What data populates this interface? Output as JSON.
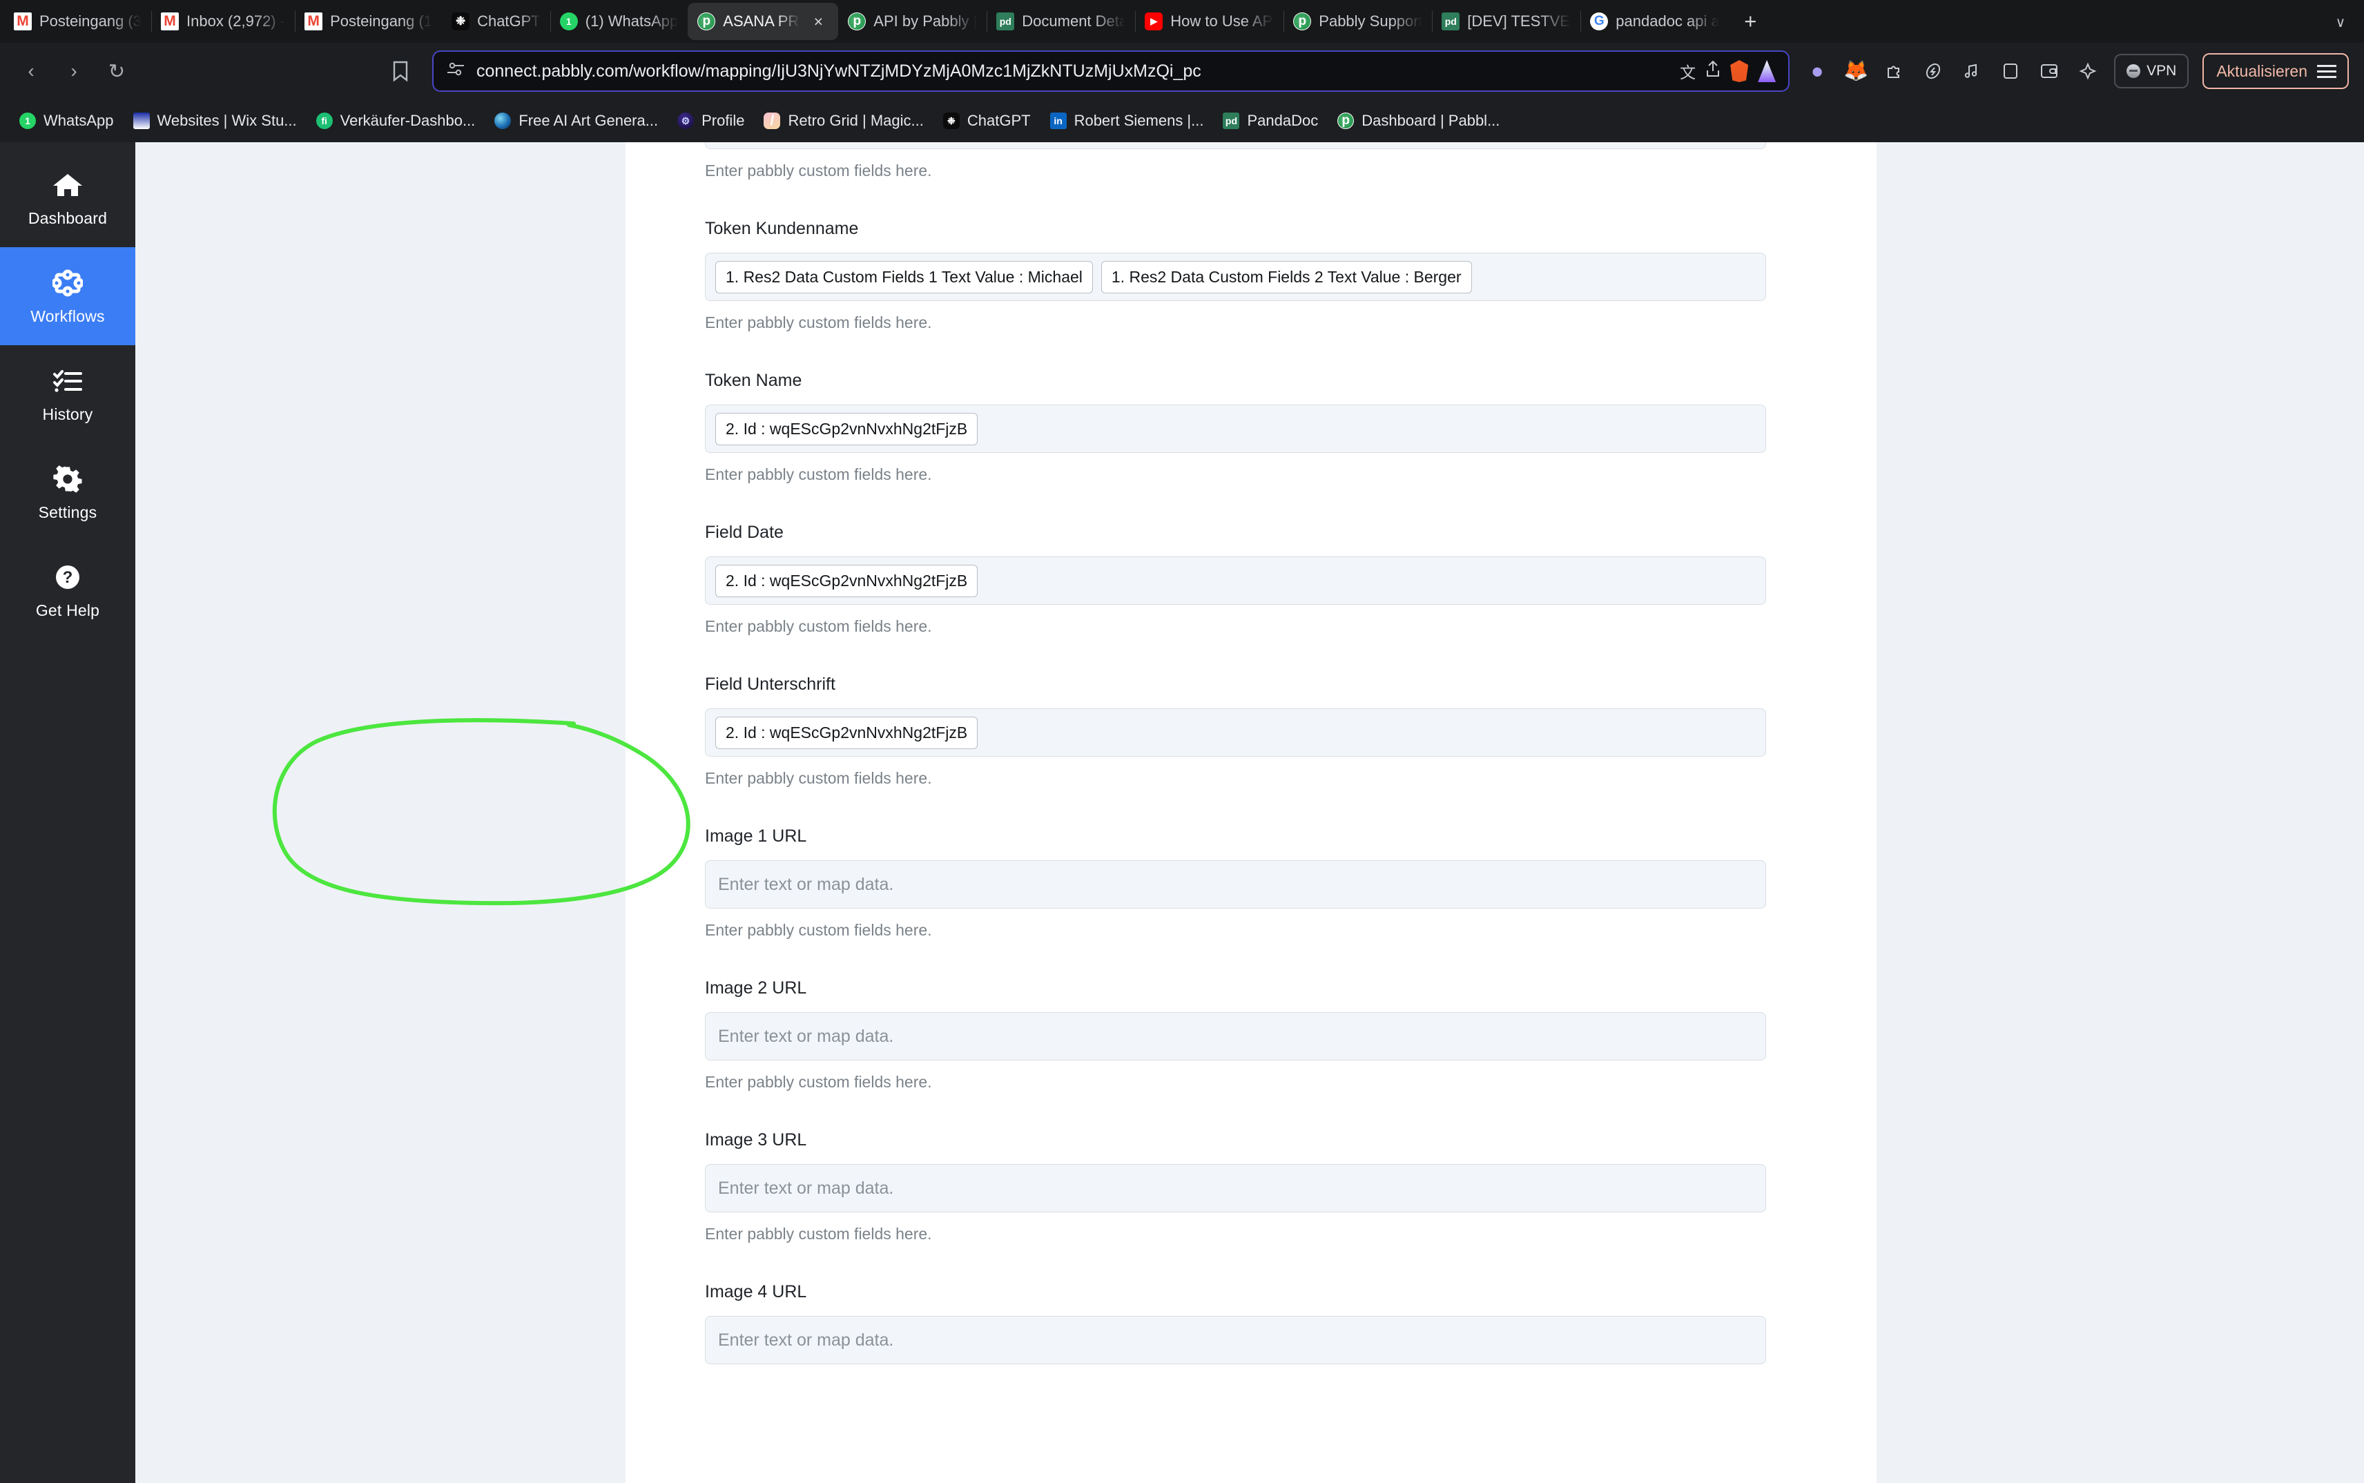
{
  "browser": {
    "tabs": [
      {
        "title": "Posteingang (3",
        "favicon": "gmail-icon",
        "active": false,
        "sep": false
      },
      {
        "title": "Inbox (2,972) -",
        "favicon": "gmail-icon",
        "active": false,
        "sep": true
      },
      {
        "title": "Posteingang (1",
        "favicon": "gmail-icon",
        "active": false,
        "sep": true
      },
      {
        "title": "ChatGPT",
        "favicon": "chatgpt-icon",
        "active": false,
        "sep": false
      },
      {
        "title": "(1) WhatsApp",
        "favicon": "whatsapp-icon",
        "active": false,
        "sep": true
      },
      {
        "title": "ASANA PRO",
        "favicon": "pabbly-icon",
        "active": true,
        "sep": false
      },
      {
        "title": "API by Pabbly |",
        "favicon": "pabbly-icon",
        "active": false,
        "sep": false
      },
      {
        "title": "Document Deta",
        "favicon": "pandadoc-icon",
        "active": false,
        "sep": true
      },
      {
        "title": "How to Use API",
        "favicon": "youtube-icon",
        "active": false,
        "sep": true
      },
      {
        "title": "Pabbly Support",
        "favicon": "pabbly-icon",
        "active": false,
        "sep": true
      },
      {
        "title": "[DEV] TESTVER",
        "favicon": "pandadoc-icon",
        "active": false,
        "sep": true
      },
      {
        "title": "pandadoc api a",
        "favicon": "google-icon",
        "active": false,
        "sep": true
      }
    ],
    "new_tab_label": "+",
    "tab_list_label": "∨",
    "close_tab_label": "×",
    "toolbar": {
      "back_label": "‹",
      "forward_label": "›",
      "reload_label": "↻",
      "bookmark_label": "☆",
      "url": "connect.pabbly.com/workflow/mapping/IjU3NjYwNTZjMDYzMjA0Mzc1MjZkNTUzMjUxMzQi_pc",
      "translate_label": "文",
      "share_label": "↑",
      "vpn_label": "VPN",
      "update_label": "Aktualisieren"
    },
    "bookmarks": [
      {
        "title": "WhatsApp",
        "favicon": "whatsapp-icon"
      },
      {
        "title": "Websites | Wix Stu...",
        "favicon": "wix-icon"
      },
      {
        "title": "Verkäufer-Dashbo...",
        "favicon": "fiverr-icon"
      },
      {
        "title": "Free AI Art Genera...",
        "favicon": "aiart-icon"
      },
      {
        "title": "Profile",
        "favicon": "profile-icon"
      },
      {
        "title": "Retro Grid | Magic...",
        "favicon": "retro-icon"
      },
      {
        "title": "ChatGPT",
        "favicon": "chatgpt-icon"
      },
      {
        "title": "Robert Siemens |...",
        "favicon": "linkedin-icon"
      },
      {
        "title": "PandaDoc",
        "favicon": "pandadoc-icon"
      },
      {
        "title": "Dashboard | Pabbl...",
        "favicon": "pabbly-icon"
      }
    ]
  },
  "sidebar": {
    "items": [
      {
        "label": "Dashboard",
        "icon": "home-icon",
        "active": false
      },
      {
        "label": "Workflows",
        "icon": "workflow-icon",
        "active": true
      },
      {
        "label": "History",
        "icon": "history-icon",
        "active": false
      },
      {
        "label": "Settings",
        "icon": "gear-icon",
        "active": false
      },
      {
        "label": "Get Help",
        "icon": "help-icon",
        "active": false
      }
    ],
    "active_color": "#3b7df5"
  },
  "form": {
    "help_text": "Enter pabbly custom fields here.",
    "map_placeholder": "Enter text or map data.",
    "top_partial_help": "Enter pabbly custom fields here.",
    "fields": [
      {
        "label": "Token Kundenname",
        "chips": [
          "1. Res2 Data Custom Fields 1 Text Value : Michael",
          "1. Res2 Data Custom Fields 2 Text Value : Berger"
        ],
        "help": "Enter pabbly custom fields here."
      },
      {
        "label": "Token Name",
        "chips": [
          "2. Id : wqEScGp2vnNvxhNg2tFjzB"
        ],
        "help": "Enter pabbly custom fields here."
      },
      {
        "label": "Field Date",
        "chips": [
          "2. Id : wqEScGp2vnNvxhNg2tFjzB"
        ],
        "help": "Enter pabbly custom fields here."
      },
      {
        "label": "Field Unterschrift",
        "chips": [
          "2. Id : wqEScGp2vnNvxhNg2tFjzB"
        ],
        "help": "Enter pabbly custom fields here.",
        "highlighted": true
      },
      {
        "label": "Image 1 URL",
        "chips": [],
        "placeholder": "Enter text or map data.",
        "help": "Enter pabbly custom fields here."
      },
      {
        "label": "Image 2 URL",
        "chips": [],
        "placeholder": "Enter text or map data.",
        "help": "Enter pabbly custom fields here."
      },
      {
        "label": "Image 3 URL",
        "chips": [],
        "placeholder": "Enter text or map data.",
        "help": "Enter pabbly custom fields here."
      },
      {
        "label": "Image 4 URL",
        "chips": [],
        "placeholder": "Enter text or map data.",
        "help": ""
      }
    ]
  },
  "annotation": {
    "color": "#4ce63f",
    "shape": "hand-drawn-ellipse",
    "targets": "Field Unterschrift"
  }
}
